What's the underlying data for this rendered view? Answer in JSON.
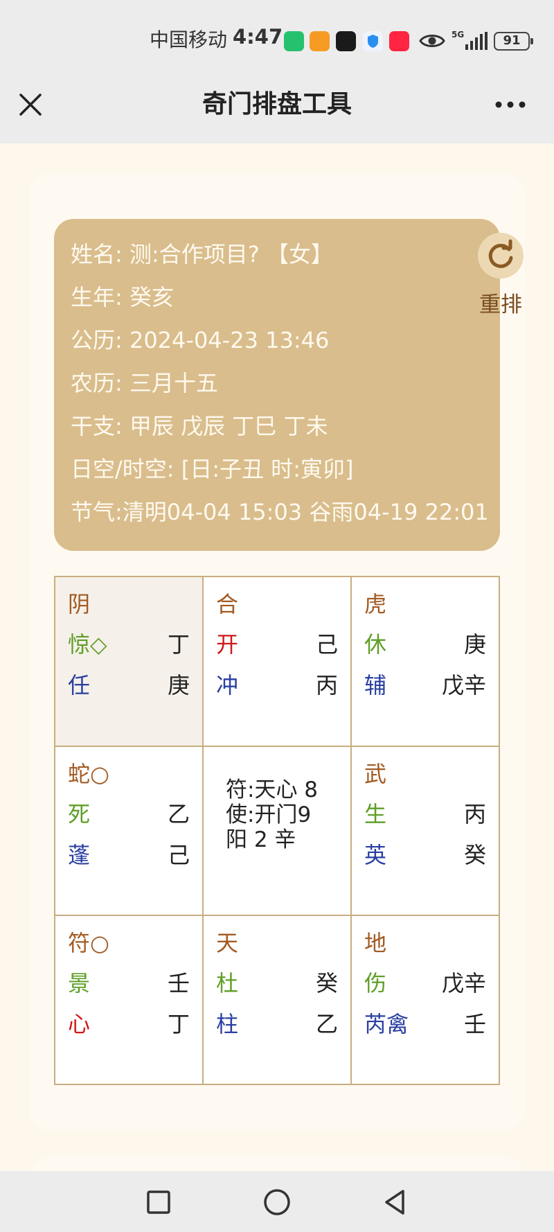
{
  "status_bar": {
    "carrier": "中国移动",
    "time": "4:47",
    "network": "5G",
    "battery": "91",
    "app_icons": [
      {
        "name": "wechat-app-icon",
        "color": "#25c16f"
      },
      {
        "name": "orange-app-icon",
        "color": "#f59b24"
      },
      {
        "name": "black-app-icon",
        "color": "#1a1a1a"
      },
      {
        "name": "shield-app-icon",
        "color": "#2a8ff0"
      },
      {
        "name": "xiaohongshu-app-icon",
        "color": "#ff2442"
      }
    ]
  },
  "header": {
    "title": "奇门排盘工具"
  },
  "info": {
    "name": "姓名: 测:合作项目? 【女】",
    "birth_year": "生年: 癸亥",
    "solar": "公历: 2024-04-23 13:46",
    "lunar": "农历: 三月十五",
    "ganzhi": "干支: 甲辰 戊辰 丁巳 丁未",
    "kong": "日空/时空: [日:子丑 时:寅卯]",
    "jieqi": "节气:清明04-04 15:03 谷雨04-19 22:01",
    "redo_label": "重排"
  },
  "grid": {
    "cells": [
      {
        "god": "阴",
        "door": "惊◇",
        "star": "任",
        "stem_a": "丁",
        "stem_b": "庚"
      },
      {
        "god": "合",
        "door": "开",
        "star": "冲",
        "stem_a": "己",
        "stem_b": "丙"
      },
      {
        "god": "虎",
        "door": "休",
        "star": "辅",
        "stem_a": "庚",
        "stem_b": "戊辛"
      },
      {
        "god": "蛇○",
        "door": "死",
        "star": "蓬",
        "stem_a": "乙",
        "stem_b": "己"
      },
      {
        "center_line1": "符:天心 8",
        "center_line2": "使:开门9",
        "center_line3": "阳 2 辛"
      },
      {
        "god": "武",
        "door": "生",
        "star": "英",
        "stem_a": "丙",
        "stem_b": "癸"
      },
      {
        "god": "符○",
        "door": "景",
        "star": "心",
        "stem_a": "壬",
        "stem_b": "丁"
      },
      {
        "god": "天",
        "door": "杜",
        "star": "柱",
        "stem_a": "癸",
        "stem_b": "乙"
      },
      {
        "god": "地",
        "door": "伤",
        "star": "芮禽",
        "stem_a": "戊辛",
        "stem_b": "壬"
      }
    ]
  },
  "colors": {
    "god": "#a25a22",
    "door": "#5e9e26",
    "star": "#2a3fa0",
    "highlight_red": "#d01818",
    "panel": "#d9bd8c"
  }
}
